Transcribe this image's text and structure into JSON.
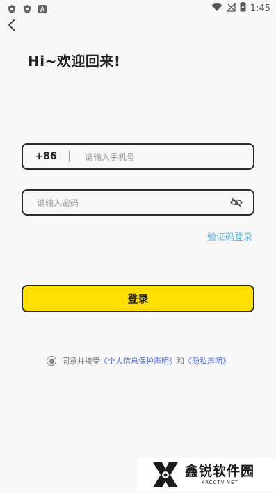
{
  "status_bar": {
    "time": "1:45",
    "icons": [
      "shield-icon",
      "shield-icon",
      "a-icon"
    ],
    "right_icons": [
      "wifi-icon",
      "no-signal-icon",
      "battery-charging-icon"
    ]
  },
  "nav": {
    "back_icon": "chevron-left-icon"
  },
  "header": {
    "title": "Hi~欢迎回来!"
  },
  "phone_field": {
    "country_code": "+86",
    "placeholder": "请输入手机号"
  },
  "password_field": {
    "placeholder": "请输入密码",
    "toggle_icon": "eye-off-icon"
  },
  "code_login_link": "验证码登录",
  "login_button": {
    "label": "登录"
  },
  "agreement": {
    "prefix": "同意并接受",
    "privacy_protection": "《个人信息保护声明》",
    "and": "和",
    "privacy_statement": "《隐私声明》"
  },
  "watermark": {
    "brand": "鑫锐软件园",
    "url": "XRCCTV.NET"
  },
  "colors": {
    "background": "#f7f7f7",
    "primary_button": "#ffde00",
    "link": "#5ab0d8",
    "agreement_link": "#4a6fd1",
    "border": "#2b2b2b"
  }
}
